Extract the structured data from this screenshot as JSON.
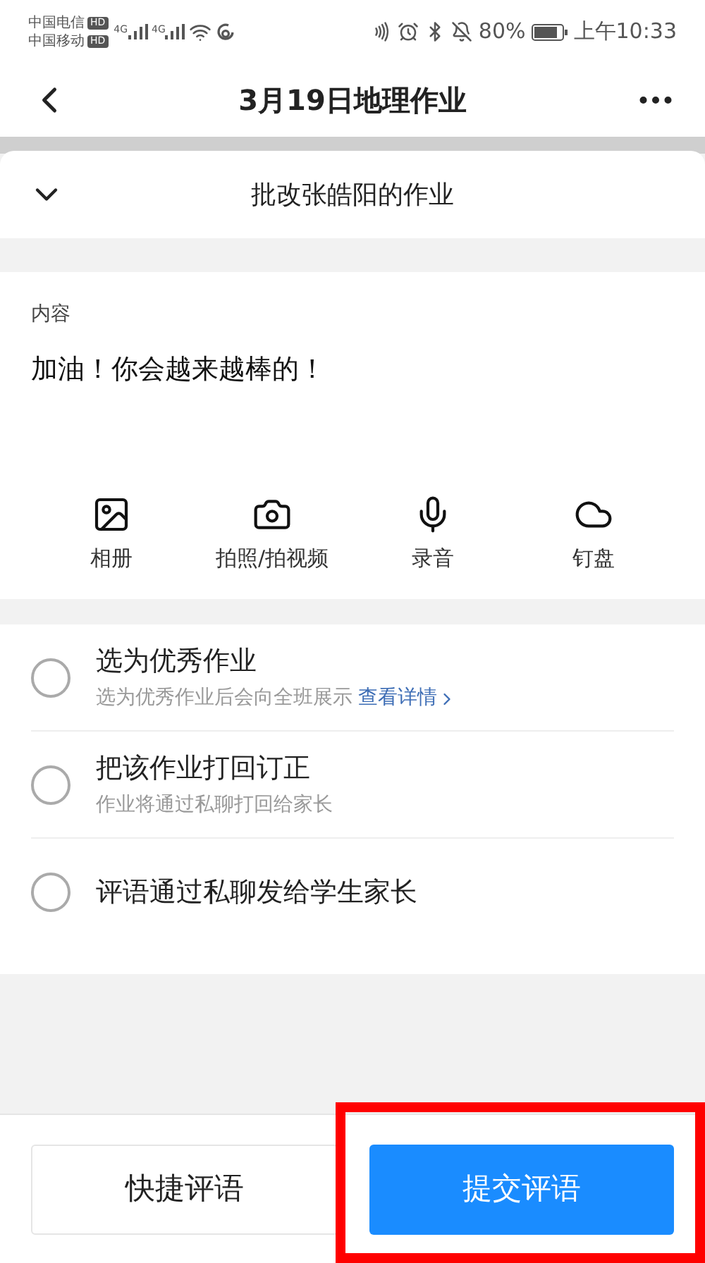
{
  "status_bar": {
    "carriers": [
      {
        "name": "中国电信",
        "badge": "HD"
      },
      {
        "name": "中国移动",
        "badge": "HD"
      }
    ],
    "network_labels": [
      "4G",
      "4G"
    ],
    "battery": "80%",
    "time": "上午10:33"
  },
  "header": {
    "title": "3月19日地理作业"
  },
  "sheet": {
    "title": "批改张皓阳的作业",
    "expanded": true
  },
  "content": {
    "label": "内容",
    "value": "加油！你会越来越棒的！"
  },
  "attachments": [
    {
      "kind": "album",
      "label": "相册"
    },
    {
      "kind": "camera",
      "label": "拍照/拍视频"
    },
    {
      "kind": "voice",
      "label": "录音"
    },
    {
      "kind": "cloud",
      "label": "钉盘"
    }
  ],
  "options": [
    {
      "title": "选为优秀作业",
      "hint": "选为优秀作业后会向全班展示",
      "link": "查看详情",
      "selected": false
    },
    {
      "title": "把该作业打回订正",
      "hint": "作业将通过私聊打回给家长",
      "selected": false
    },
    {
      "title": "评语通过私聊发给学生家长",
      "selected": false
    }
  ],
  "buttons": [
    {
      "kind": "secondary",
      "label": "快捷评语"
    },
    {
      "kind": "primary",
      "label": "提交评语"
    }
  ],
  "annotation": {
    "kind": "highlight-box"
  }
}
